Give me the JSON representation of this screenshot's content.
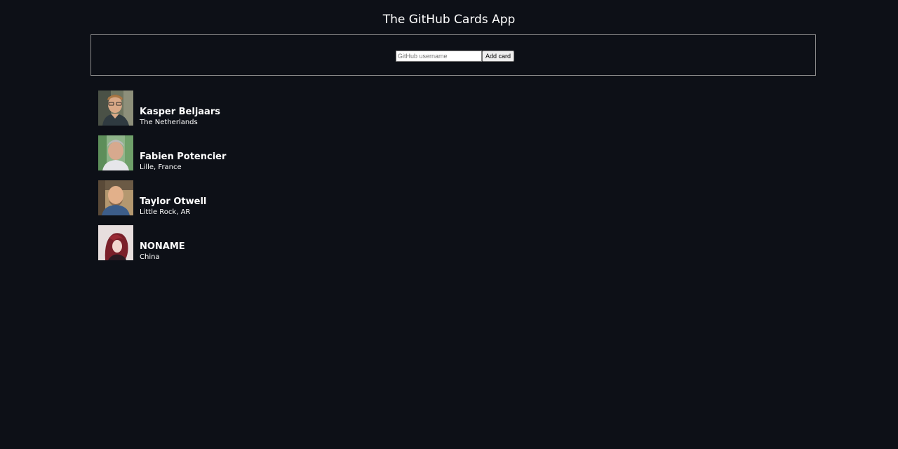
{
  "app": {
    "title": "The GitHub Cards App"
  },
  "form": {
    "input_placeholder": "GitHub username",
    "input_value": "",
    "submit_label": "Add card"
  },
  "cards": [
    {
      "name": "Kasper Beljaars",
      "company": "The Netherlands",
      "avatar_icon": "avatar-photo"
    },
    {
      "name": "Fabien Potencier",
      "company": "Lille, France",
      "avatar_icon": "avatar-photo"
    },
    {
      "name": "Taylor Otwell",
      "company": "Little Rock, AR",
      "avatar_icon": "avatar-photo"
    },
    {
      "name": "NONAME",
      "company": "China",
      "avatar_icon": "avatar-photo"
    }
  ],
  "colors": {
    "background": "#0d1017",
    "text": "#ffffff",
    "form_border": "#8a8a8a"
  }
}
